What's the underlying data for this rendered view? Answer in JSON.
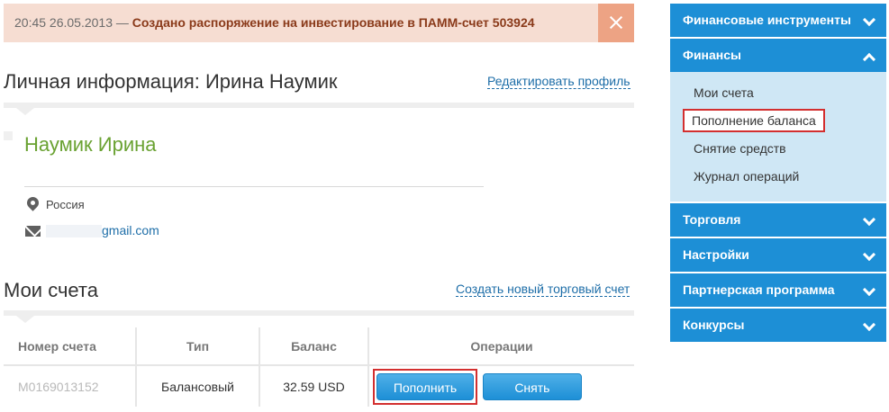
{
  "notification": {
    "time": "20:45 26.05.2013 —",
    "message": "Создано распоряжение на инвестирование в ПАММ-счет 503924"
  },
  "profile": {
    "title": "Личная информация: Ирина Наумик",
    "edit_link": "Редактировать профиль",
    "name": "Наумик Ирина",
    "country": "Россия",
    "email_suffix": "gmail.com"
  },
  "accounts": {
    "title": "Мои счета",
    "create_link": "Создать новый торговый счет",
    "columns": [
      "Номер счета",
      "Тип",
      "Баланс",
      "Операции"
    ],
    "rows": [
      {
        "number": "M0169013152",
        "type": "Балансовый",
        "balance": "32.59 USD"
      }
    ],
    "replenish_button": "Пополнить",
    "withdraw_button": "Снять"
  },
  "sidebar": {
    "items": [
      {
        "label": "Финансовые инструменты"
      },
      {
        "label": "Финансы"
      },
      {
        "label": "Торговля"
      },
      {
        "label": "Настройки"
      },
      {
        "label": "Партнерская программа"
      },
      {
        "label": "Конкурсы"
      }
    ],
    "finance_sub": [
      {
        "label": "Мои счета"
      },
      {
        "label": "Пополнение баланса"
      },
      {
        "label": "Снятие средств"
      },
      {
        "label": "Журнал операций"
      }
    ]
  },
  "colors": {
    "accent": "#1d8fd6",
    "notice_bg": "#f6ddd2",
    "name_green": "#6aa232",
    "highlight_red": "#d32f2f"
  }
}
